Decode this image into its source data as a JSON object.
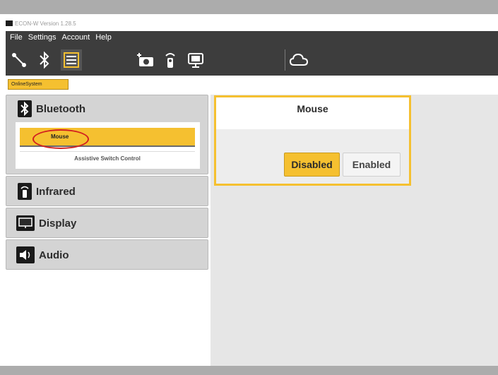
{
  "window": {
    "title": "ECON-W Version 1.28.5"
  },
  "menu": {
    "items": [
      "File",
      "Settings",
      "Account",
      "Help"
    ]
  },
  "toolbar": {
    "tools": [
      "link-icon",
      "bluetooth-icon",
      "list-icon",
      "camera-add-icon",
      "remote-icon",
      "display-icon",
      "cloud-icon"
    ]
  },
  "tabs": {
    "active": "OnlineSystem"
  },
  "sidebar": {
    "bluetooth": {
      "label": "Bluetooth",
      "items": [
        "Mouse",
        "Assistive Switch Control"
      ],
      "selected_index": 0
    },
    "infrared": {
      "label": "Infrared"
    },
    "display": {
      "label": "Display"
    },
    "audio": {
      "label": "Audio"
    }
  },
  "panel": {
    "title": "Mouse",
    "options": [
      "Disabled",
      "Enabled"
    ],
    "selected": "Disabled"
  },
  "colors": {
    "accent": "#f5c030",
    "toolbar": "#3d3d3d",
    "highlight_circle": "#d22020"
  }
}
